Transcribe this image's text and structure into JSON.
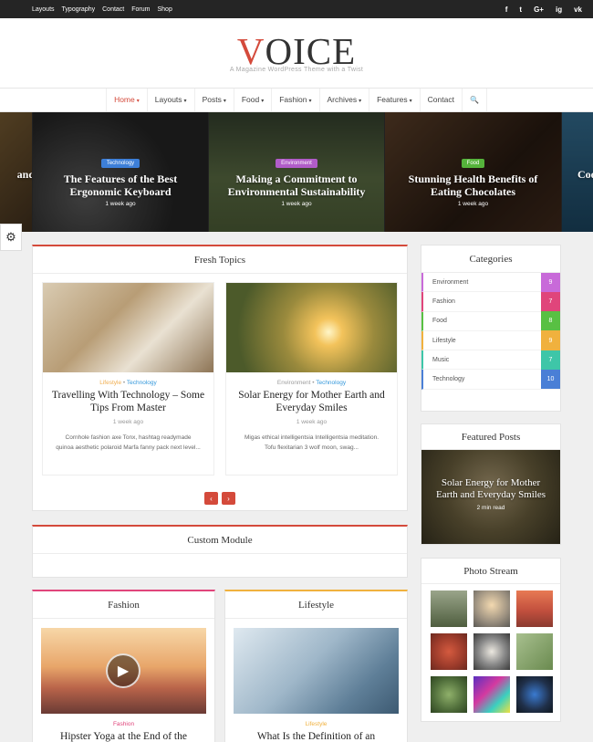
{
  "topbar": {
    "links": [
      "Layouts",
      "Typography",
      "Contact",
      "Forum",
      "Shop"
    ],
    "social": [
      "f",
      "t",
      "G+",
      "ig",
      "vk"
    ]
  },
  "header": {
    "logo_first": "V",
    "logo_rest": "OICE",
    "tagline": "A Magazine WordPress Theme with a Twist"
  },
  "nav": {
    "items": [
      {
        "label": "Home",
        "caret": "▾"
      },
      {
        "label": "Layouts",
        "caret": "▾"
      },
      {
        "label": "Posts",
        "caret": "▾"
      },
      {
        "label": "Food",
        "caret": "▾"
      },
      {
        "label": "Fashion",
        "caret": "▾"
      },
      {
        "label": "Archives",
        "caret": "▾"
      },
      {
        "label": "Features",
        "caret": "▾"
      },
      {
        "label": "Contact",
        "caret": ""
      }
    ],
    "search_icon": "🔍"
  },
  "slider": {
    "partial_left": "and",
    "partial_right": "Coo",
    "slides": [
      {
        "badge": "Technology",
        "badge_color": "#3d7fd8",
        "title": "The Features of the Best Ergonomic Keyboard",
        "time": "1 week ago"
      },
      {
        "badge": "Environment",
        "badge_color": "#b15cc9",
        "title": "Making a Commitment to Environmental Sustainability",
        "time": "1 week ago"
      },
      {
        "badge": "Food",
        "badge_color": "#55b33b",
        "title": "Stunning Health Benefits of Eating Chocolates",
        "time": "1 week ago"
      }
    ]
  },
  "settings_icon": "⚙",
  "fresh_topics": {
    "title": "Fresh Topics",
    "cards": [
      {
        "cat1": "Lifestyle",
        "sep": "•",
        "cat2": "Technology",
        "title": "Travelling With Technology – Some Tips From Master",
        "date": "1 week ago",
        "excerpt": "Cornhole fashion axe Tonx, hashtag readymade quinoa aesthetic polaroid Marfa fanny pack next level..."
      },
      {
        "cat1": "Environment",
        "sep": "•",
        "cat2": "Technology",
        "title": "Solar Energy for Mother Earth and Everyday Smiles",
        "date": "1 week ago",
        "excerpt": "Migas ethical intelligentsia Intelligentsia meditation. Tofu flexitarian 3 wolf moon, swag..."
      }
    ],
    "prev": "‹",
    "next": "›"
  },
  "custom_module": {
    "title": "Custom Module"
  },
  "fashion": {
    "title": "Fashion",
    "cat": "Fashion",
    "post_title": "Hipster Yoga at the End of the",
    "play_icon": "▶"
  },
  "lifestyle": {
    "title": "Lifestyle",
    "cat": "Lifestyle",
    "post_title": "What Is the Definition of an"
  },
  "categories": {
    "title": "Categories",
    "items": [
      {
        "name": "Environment",
        "count": "9",
        "color": "#c86ad9"
      },
      {
        "name": "Fashion",
        "count": "7",
        "color": "#e0457b"
      },
      {
        "name": "Food",
        "count": "8",
        "color": "#58c043"
      },
      {
        "name": "Lifestyle",
        "count": "9",
        "color": "#f0b13e"
      },
      {
        "name": "Music",
        "count": "7",
        "color": "#3ec6a8"
      },
      {
        "name": "Technology",
        "count": "10",
        "color": "#4a7fd6"
      }
    ]
  },
  "featured_posts": {
    "title": "Featured Posts",
    "post_title": "Solar Energy for Mother Earth and Everyday Smiles",
    "time": "2 min read"
  },
  "photo_stream": {
    "title": "Photo Stream"
  }
}
